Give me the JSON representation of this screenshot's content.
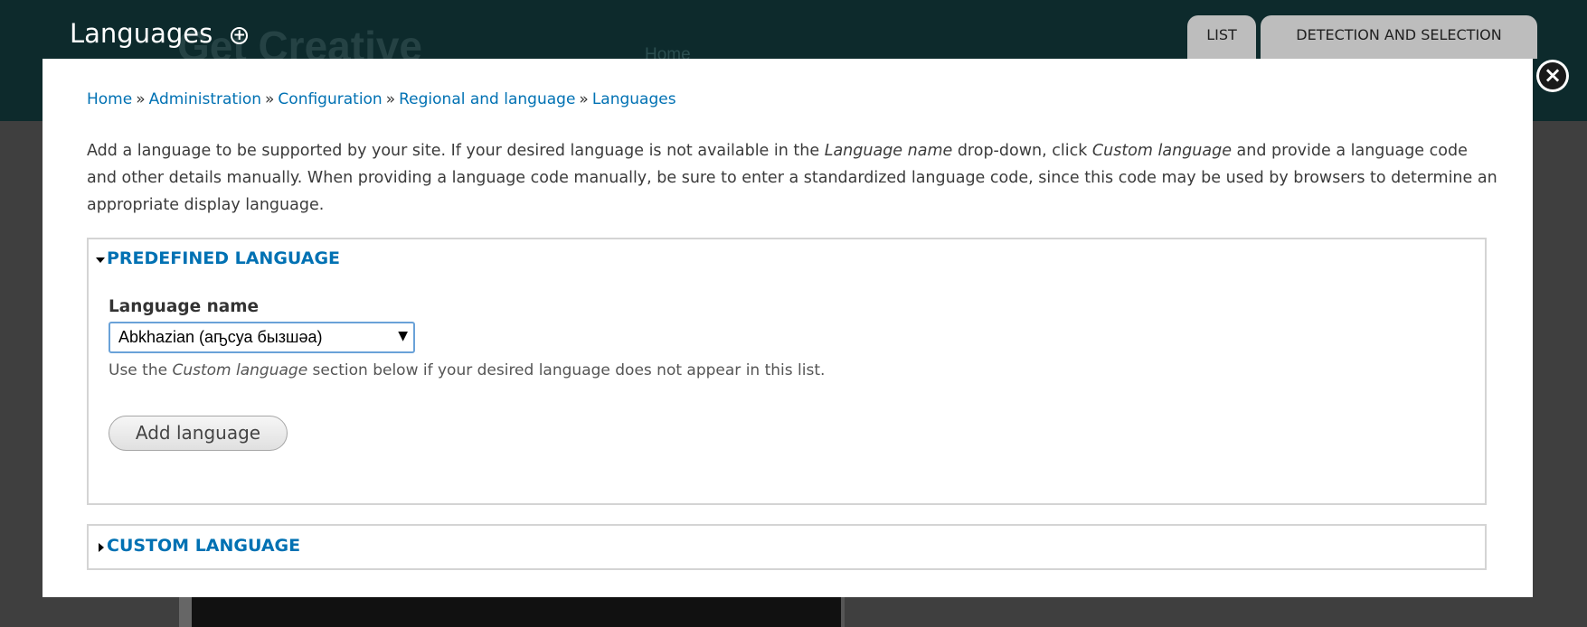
{
  "background": {
    "site_title": "Get Creative",
    "nav_home": "Home"
  },
  "overlay": {
    "title": "Languages",
    "shortcut_icon": "plus-circle-icon",
    "tabs": [
      {
        "label": "LIST"
      },
      {
        "label": "DETECTION AND SELECTION"
      }
    ],
    "close_icon": "close-icon"
  },
  "breadcrumb": {
    "items": [
      "Home",
      "Administration",
      "Configuration",
      "Regional and language",
      "Languages"
    ],
    "separator": "»"
  },
  "intro": {
    "part1": "Add a language to be supported by your site. If your desired language is not available in the ",
    "em1": "Language name",
    "part2": " drop-down, click ",
    "em2": "Custom language",
    "part3": " and provide a language code and other details manually. When providing a language code manually, be sure to enter a standardized language code, since this code may be used by browsers to determine an appropriate display language."
  },
  "predefined": {
    "legend": "PREDEFINED LANGUAGE",
    "expanded": true,
    "field_label": "Language name",
    "selected_value": "Abkhazian (аҧсуа бызшәа)",
    "desc_part1": "Use the ",
    "desc_em": "Custom language",
    "desc_part2": " section below if your desired language does not appear in this list.",
    "add_button": "Add language"
  },
  "custom": {
    "legend": "CUSTOM LANGUAGE",
    "expanded": false
  },
  "colors": {
    "link": "#0071b3",
    "header_bg": "#0d2a2c",
    "tab_bg": "#bdbdbd",
    "overlay_dim": "#3f3f3f"
  }
}
